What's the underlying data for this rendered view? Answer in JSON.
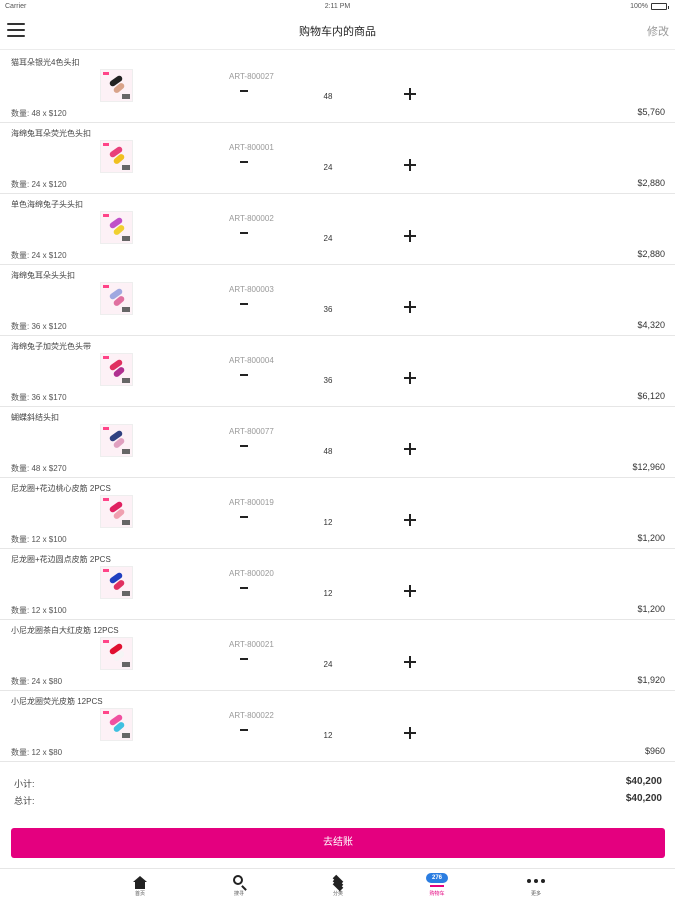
{
  "status_bar": {
    "carrier": "Carrier",
    "time": "2:11 PM",
    "battery": "100%"
  },
  "header": {
    "title": "购物车内的商品",
    "edit_label": "修改"
  },
  "items": [
    {
      "name": "猫耳朵银光4色头扣",
      "code": "ART-800027",
      "quantity_line": "数量: 48 x $120",
      "count": "48",
      "amount": "$5,760",
      "thumb_colors": [
        "#222222",
        "#d9a38a"
      ]
    },
    {
      "name": "海绵兔耳朵荧光色头扣",
      "code": "ART-800001",
      "quantity_line": "数量: 24 x $120",
      "count": "24",
      "amount": "$2,880",
      "thumb_colors": [
        "#e8407a",
        "#f0c020"
      ]
    },
    {
      "name": "单色海绵兔子头头扣",
      "code": "ART-800002",
      "quantity_line": "数量: 24 x $120",
      "count": "24",
      "amount": "$2,880",
      "thumb_colors": [
        "#c050c8",
        "#f0d030"
      ]
    },
    {
      "name": "海绵兔耳朵头头扣",
      "code": "ART-800003",
      "quantity_line": "数量: 36 x $120",
      "count": "36",
      "amount": "$4,320",
      "thumb_colors": [
        "#a0a8e0",
        "#e070a0"
      ]
    },
    {
      "name": "海绵兔子加荧光色头带",
      "code": "ART-800004",
      "quantity_line": "数量: 36 x $170",
      "count": "36",
      "amount": "$6,120",
      "thumb_colors": [
        "#e03060",
        "#b03090"
      ]
    },
    {
      "name": "蝴蝶斜结头扣",
      "code": "ART-800077",
      "quantity_line": "数量: 48 x $270",
      "count": "48",
      "amount": "$12,960",
      "thumb_colors": [
        "#304080",
        "#e0a0c0"
      ]
    },
    {
      "name": "尼龙圈+花边桃心皮筋 2PCS",
      "code": "ART-800019",
      "quantity_line": "数量: 12 x $100",
      "count": "12",
      "amount": "$1,200",
      "thumb_colors": [
        "#e02060",
        "#f0a0b0"
      ]
    },
    {
      "name": "尼龙圈+花边圆点皮筋 2PCS",
      "code": "ART-800020",
      "quantity_line": "数量: 12 x $100",
      "count": "12",
      "amount": "$1,200",
      "thumb_colors": [
        "#2040c0",
        "#e03060"
      ]
    },
    {
      "name": "小尼龙圈茶白大红皮筋 12PCS",
      "code": "ART-800021",
      "quantity_line": "数量: 24 x $80",
      "count": "24",
      "amount": "$1,920",
      "thumb_colors": [
        "#e01030",
        "#f5f5f5"
      ]
    },
    {
      "name": "小尼龙圈荧光皮筋 12PCS",
      "code": "ART-800022",
      "quantity_line": "数量: 12 x $80",
      "count": "12",
      "amount": "$960",
      "thumb_colors": [
        "#f050a0",
        "#40c0e0"
      ]
    }
  ],
  "totals": {
    "subtotal_label": "小计:",
    "subtotal_value": "$40,200",
    "total_label": "总计:",
    "total_value": "$40,200"
  },
  "checkout_label": "去结账",
  "tabs": [
    {
      "label": "首页",
      "icon": "home-icon"
    },
    {
      "label": "搜寻",
      "icon": "search-icon"
    },
    {
      "label": "分类",
      "icon": "layers-icon"
    },
    {
      "label": "购物车",
      "icon": "cart-icon",
      "badge": "276",
      "active": true
    },
    {
      "label": "更多",
      "icon": "more-icon"
    }
  ],
  "colors": {
    "accent": "#e4007f",
    "badge": "#2b7de1"
  }
}
